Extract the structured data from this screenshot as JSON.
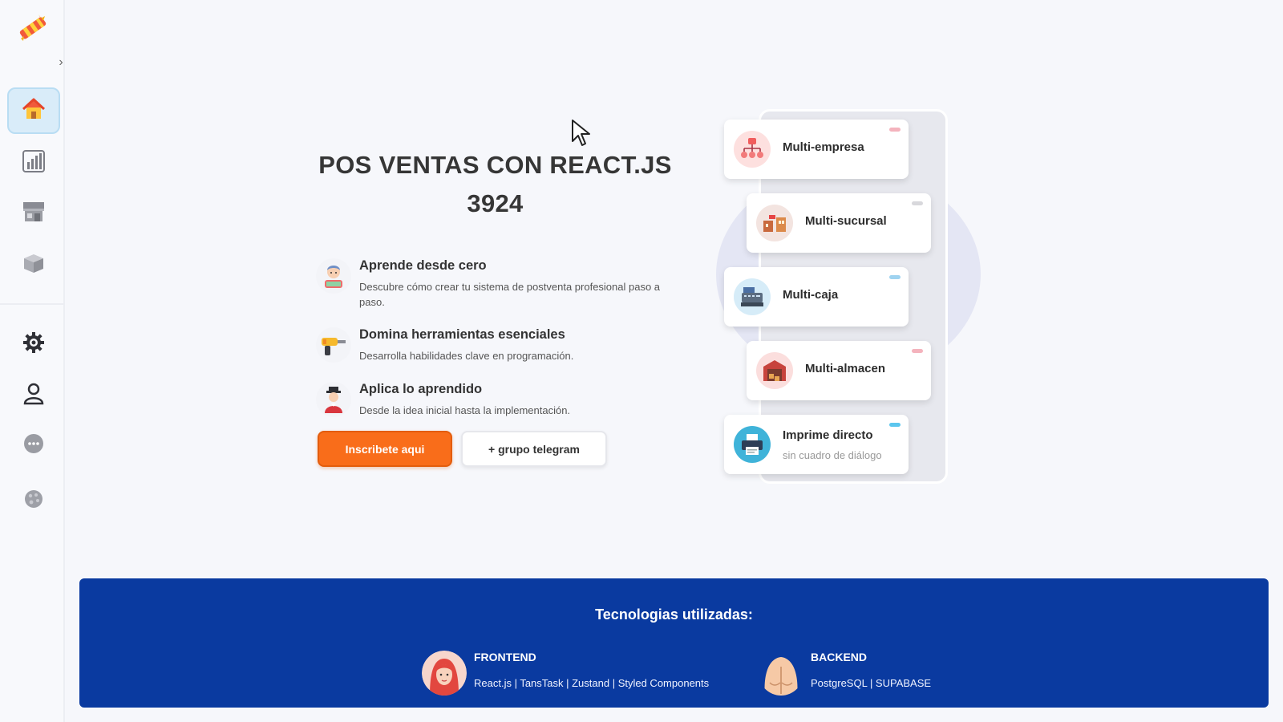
{
  "sidebar": {
    "toggle_glyph": "›",
    "items": [
      {
        "icon": "home-icon",
        "active": true
      },
      {
        "icon": "bar-chart-icon",
        "active": false
      },
      {
        "icon": "store-icon",
        "active": false
      },
      {
        "icon": "box-icon",
        "active": false
      },
      {
        "icon": "gear-icon",
        "active": false
      },
      {
        "icon": "user-icon",
        "active": false
      },
      {
        "icon": "more-icon",
        "active": false
      },
      {
        "icon": "theme-icon",
        "active": false
      }
    ]
  },
  "hero": {
    "title_line1": "POS VENTAS CON REACT.JS",
    "title_line2": "3924",
    "features": [
      {
        "title": "Aprende desde cero",
        "desc": "Descubre cómo crear tu sistema de postventa profesional paso a paso."
      },
      {
        "title": "Domina herramientas esenciales",
        "desc": "Desarrolla habilidades clave en programación."
      },
      {
        "title": "Aplica lo aprendido",
        "desc": "Desde la idea inicial hasta la implementación."
      }
    ],
    "primary_button": "Inscribete aqui",
    "secondary_button": "+ grupo telegram"
  },
  "cards": [
    {
      "label": "Multi-empresa",
      "sub": "",
      "dot_color": "#f4b3bd"
    },
    {
      "label": "Multi-sucursal",
      "sub": "",
      "dot_color": "#d8d8dc"
    },
    {
      "label": "Multi-caja",
      "sub": "",
      "dot_color": "#9fd3f0"
    },
    {
      "label": "Multi-almacen",
      "sub": "",
      "dot_color": "#f4b3bd"
    },
    {
      "label": "Imprime directo",
      "sub": "sin cuadro de diálogo",
      "dot_color": "#5cc6ee"
    }
  ],
  "banner": {
    "title": "Tecnologias utilizadas:",
    "frontend_label": "FRONTEND",
    "frontend_stack": "React.js | TansTask | Zustand | Styled Components",
    "backend_label": "BACKEND",
    "backend_stack": "PostgreSQL | SUPABASE"
  },
  "colors": {
    "accent": "#f96d1a",
    "banner_bg": "#0a3aa0",
    "sidebar_active": "#d9ecf9"
  }
}
